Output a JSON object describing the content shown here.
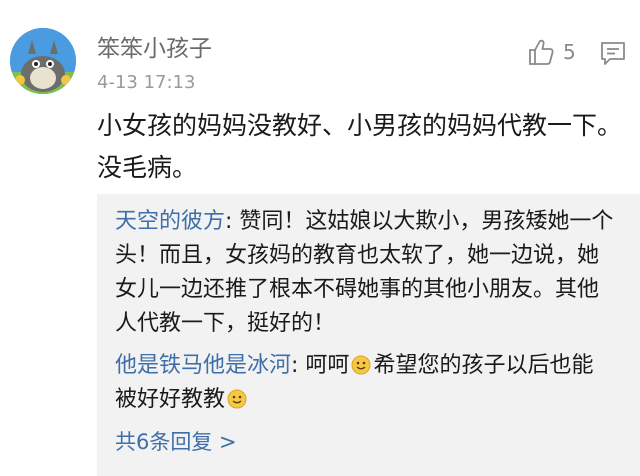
{
  "comment": {
    "username": "笨笨小孩子",
    "timestamp": "4-13 17:13",
    "like_count": "5",
    "icons": {
      "avatar": "cartoon-avatar-icon",
      "like": "thumbs-up-icon",
      "reply": "comment-reply-icon"
    },
    "body": "小女孩的妈妈没教好、小男孩的妈妈代教一下。没毛病。"
  },
  "replies": {
    "items": [
      {
        "author": "天空的彼方",
        "separator": ": ",
        "text": "赞同！这姑娘以大欺小，男孩矮她一个头！而且，女孩妈的教育也太软了，她一边说，她女儿一边还推了根本不碍她事的其他小朋友。其他人代教一下，挺好的！"
      },
      {
        "author": "他是铁马他是冰河",
        "separator": ": ",
        "text_before_emoji": "呵呵",
        "text_middle": "希望您的孩子以后也能被好好教教",
        "emoji_icon": "smiley-emoji-icon"
      }
    ],
    "more_label": "共6条回复 >"
  },
  "colors": {
    "link_blue": "#3f6fa8",
    "username_gray": "#6b6b6b",
    "reply_bg": "#f2f2f2"
  }
}
